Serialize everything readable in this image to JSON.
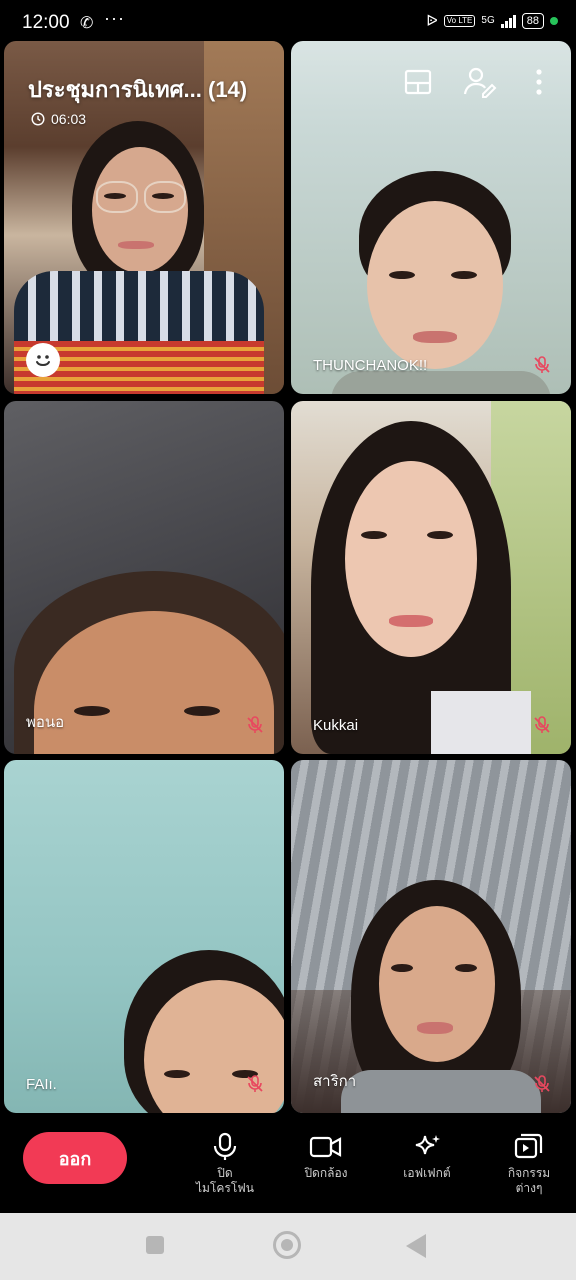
{
  "status_bar": {
    "time": "12:00",
    "call_icon": "phone-icon",
    "more": "···",
    "volte": "Vo LTE",
    "network": "5G",
    "battery": "88",
    "indicator_color": "#27c35a"
  },
  "meeting": {
    "title": "ประชุมการนิเทศ... (14)",
    "duration": "06:03"
  },
  "participants": [
    {
      "name": "",
      "muted": false
    },
    {
      "name": "THUNCHANOK!!",
      "muted": true
    },
    {
      "name": "พอนอ",
      "muted": true
    },
    {
      "name": "Kukkai",
      "muted": true
    },
    {
      "name": "FAIı.",
      "muted": true
    },
    {
      "name": "สาริกา",
      "muted": true
    }
  ],
  "controls": {
    "leave": "ออก",
    "mic_line1": "ปิด",
    "mic_line2": "ไมโครโฟน",
    "camera": "ปิดกล้อง",
    "effects": "เอฟเฟกต์",
    "activities_line1": "กิจกรรม",
    "activities_line2": "ต่างๆ"
  },
  "colors": {
    "leave_button": "#f23a55",
    "muted_icon": "#e8485f",
    "nav_bar": "#e6e6e6"
  }
}
